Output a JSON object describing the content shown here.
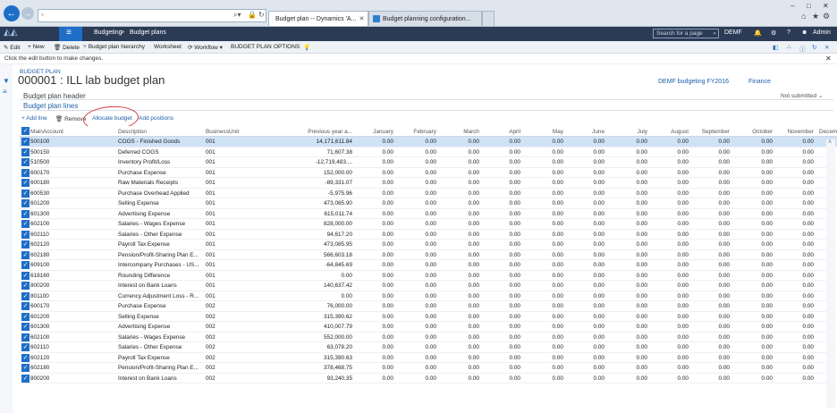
{
  "browser": {
    "address_url": "",
    "tabs": [
      {
        "label": "Budget plan -- Dynamics 'A...",
        "active": true
      },
      {
        "label": "Budget planning configuration...",
        "active": false
      }
    ],
    "win_controls": [
      "–",
      "□",
      "✕"
    ]
  },
  "appbar": {
    "module": "Budgeting",
    "breadcrumb_sep": ">",
    "page": "Budget plans",
    "search_placeholder": "Search for a page",
    "company": "DEMF",
    "user": "Admin"
  },
  "action_pane": {
    "items": [
      "Edit",
      "New",
      "Delete",
      "Budget plan hierarchy",
      "Worksheet",
      "Workflow",
      "BUDGET PLAN",
      "OPTIONS"
    ]
  },
  "message": "Click the edit button to make changes.",
  "header": {
    "kicker": "BUDGET PLAN",
    "title": "000001 : ILL lab budget plan",
    "link1": "DEMF budgeting FY2016",
    "link2": "Finance",
    "section": "Budget plan header",
    "status": "Not submitted"
  },
  "lines": {
    "title": "Budget plan lines",
    "actions": {
      "add_line": "Add line",
      "remove": "Remove",
      "allocate": "Allocate budget",
      "add_positions": "Add positions"
    },
    "columns": [
      "MainAccount",
      "Description",
      "BusinessUnit",
      "Previous year a...",
      "January",
      "February",
      "March",
      "April",
      "May",
      "June",
      "July",
      "August",
      "September",
      "October",
      "November",
      "Decemb"
    ],
    "zero": "0.00",
    "rows": [
      [
        "500100",
        "COGS - Finished Goods",
        "001",
        "14,171,611.84"
      ],
      [
        "500150",
        "Deferred COGS",
        "001",
        "71,607.38"
      ],
      [
        "510500",
        "Inventory Profit/Loss",
        "001",
        "-12,719,483...."
      ],
      [
        "600170",
        "Purchase Expense",
        "001",
        "152,000.00"
      ],
      [
        "600180",
        "Raw Materials Receipts",
        "001",
        "-89,331.07"
      ],
      [
        "600530",
        "Purchase Overhead Applied",
        "001",
        "-5,975.96"
      ],
      [
        "601200",
        "Selling Expense",
        "001",
        "473,085.90"
      ],
      [
        "601300",
        "Advertising Expense",
        "001",
        "615,011.74"
      ],
      [
        "602100",
        "Salaries - Wages Expense",
        "001",
        "828,000.00"
      ],
      [
        "602110",
        "Salaries - Other Expense",
        "001",
        "94,617.20"
      ],
      [
        "602120",
        "Payroll Tax Expense",
        "001",
        "473,085.95"
      ],
      [
        "602180",
        "Pension/Profit-Sharing Plan E...",
        "001",
        "566,603.18"
      ],
      [
        "609100",
        "Intercompany Purchases - US...",
        "001",
        "-64,845.69"
      ],
      [
        "618160",
        "Rounding Difference",
        "001",
        "0.00"
      ],
      [
        "800200",
        "Interest on Bank Loans",
        "001",
        "140,637.42"
      ],
      [
        "801100",
        "Currency Adjustment Loss - R...",
        "001",
        "0.00"
      ],
      [
        "600170",
        "Purchase Expense",
        "002",
        "76,000.00"
      ],
      [
        "601200",
        "Selling Expense",
        "002",
        "315,390.62"
      ],
      [
        "601300",
        "Advertising Expense",
        "002",
        "410,007.79"
      ],
      [
        "602100",
        "Salaries - Wages Expense",
        "002",
        "552,000.00"
      ],
      [
        "602110",
        "Salaries - Other Expense",
        "002",
        "63,078.20"
      ],
      [
        "602120",
        "Payroll Tax Expense",
        "002",
        "315,390.63"
      ],
      [
        "602180",
        "Pension/Profit-Sharing Plan E...",
        "002",
        "378,468.75"
      ],
      [
        "800200",
        "Interest on Bank Loans",
        "002",
        "93,240.35"
      ]
    ]
  },
  "colors": {
    "accent": "#1e5fa8",
    "appbar": "#2b3a55",
    "selected_row": "#cfe3f6",
    "annotation": "#d23b3b"
  }
}
